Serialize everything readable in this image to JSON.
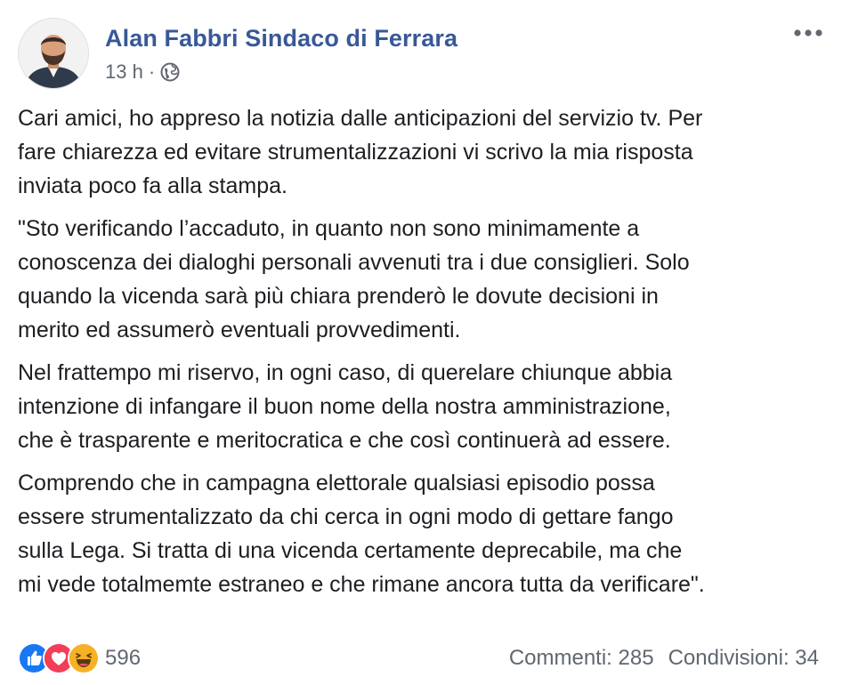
{
  "post": {
    "author": "Alan Fabbri Sindaco di Ferrara",
    "time": "13 h",
    "separator": "·",
    "privacy_icon": "globe-icon",
    "more_icon": "more-dots-icon",
    "paragraphs": [
      "Cari amici, ho appreso la notizia dalle anticipazioni del servizio tv. Per\nfare chiarezza ed evitare strumentalizzazioni vi scrivo la mia risposta\ninviata poco fa alla stampa.",
      "\"Sto verificando l’accaduto, in quanto non sono minimamente a\nconoscenza dei dialoghi personali avvenuti tra i due consiglieri. Solo\nquando la vicenda sarà più chiara prenderò le dovute decisioni in\nmerito ed assumerò eventuali provvedimenti.",
      "Nel frattempo mi riservo, in ogni caso, di querelare chiunque abbia\nintenzione di infangare il buon nome della nostra amministrazione,\nche è trasparente e meritocratica e che così continuerà ad essere.",
      "Comprendo che in campagna elettorale qualsiasi episodio possa\nessere strumentalizzato da chi cerca in ogni modo di gettare fango\nsulla Lega. Si tratta di una vicenda certamente deprecabile, ma che\nmi vede totalmemte estraneo e che rimane ancora tutta da verificare\"."
    ]
  },
  "footer": {
    "reactions": [
      "like-icon",
      "love-icon",
      "haha-icon"
    ],
    "reaction_count": "596",
    "comments": "Commenti: 285",
    "shares": "Condivisioni: 34"
  },
  "colors": {
    "author": "#385898",
    "meta": "#606770",
    "like": "#1877f2",
    "love": "#f33e58",
    "haha": "#f7b125"
  }
}
